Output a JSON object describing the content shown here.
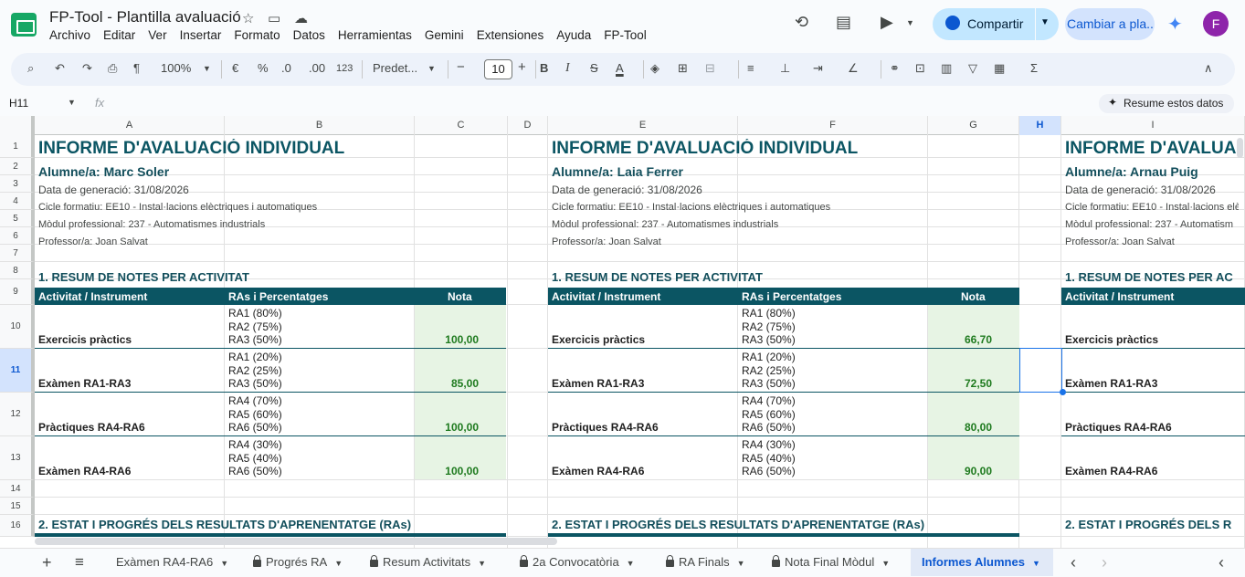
{
  "app": {
    "doc_title": "FP-Tool - Plantilla avaluació",
    "menu": [
      "Archivo",
      "Editar",
      "Ver",
      "Insertar",
      "Formato",
      "Datos",
      "Herramientas",
      "Gemini",
      "Extensiones",
      "Ayuda",
      "FP-Tool"
    ],
    "share_label": "Compartir",
    "plan_label": "Cambiar a pla...",
    "avatar_letter": "F"
  },
  "toolbar": {
    "zoom": "100%",
    "currency": "€",
    "percent": "%",
    "dec_less": ".0",
    "dec_more": ".00",
    "format_123": "123",
    "font": "Predet...",
    "font_size": "10",
    "minus": "−",
    "plus": "+"
  },
  "formula_bar": {
    "cell_ref": "H11",
    "fx": "fx",
    "summarize_label": "Resume estos datos"
  },
  "columns": [
    "A",
    "B",
    "C",
    "D",
    "E",
    "F",
    "G",
    "H",
    "I"
  ],
  "selected_column": "H",
  "rows": [
    "1",
    "2",
    "3",
    "4",
    "5",
    "6",
    "7",
    "8",
    "9",
    "10",
    "11",
    "12",
    "13",
    "14",
    "15",
    "16"
  ],
  "selected_row": "11",
  "reports": [
    {
      "title": "INFORME D'AVALUACIÓ INDIVIDUAL",
      "student": "Alumne/a: Marc Soler",
      "date": "Data de generació: 31/08/2026",
      "cycle": "Cicle formatiu: EE10 - Instal·lacions elèctriques i automatiques",
      "module": "Mòdul professional: 237 - Automatismes industrials",
      "teacher": "Professor/a: Joan Salvat",
      "section1": "1. RESUM DE NOTES PER ACTIVITAT",
      "th_activity": "Activitat / Instrument",
      "th_ras": "RAs i Percentatges",
      "th_grade": "Nota",
      "activities": [
        {
          "name": "Exercicis pràctics",
          "ras": [
            "RA1 (80%)",
            "RA2 (75%)",
            "RA3 (50%)"
          ],
          "grade": "100,00"
        },
        {
          "name": "Exàmen RA1-RA3",
          "ras": [
            "RA1 (20%)",
            "RA2 (25%)",
            "RA3 (50%)"
          ],
          "grade": "85,00"
        },
        {
          "name": "Pràctiques RA4-RA6",
          "ras": [
            "RA4 (70%)",
            "RA5 (60%)",
            "RA6 (50%)"
          ],
          "grade": "100,00"
        },
        {
          "name": "Exàmen RA4-RA6",
          "ras": [
            "RA4 (30%)",
            "RA5 (40%)",
            "RA6 (50%)"
          ],
          "grade": "100,00"
        }
      ],
      "section2": "2. ESTAT I PROGRÉS DELS RESULTATS D'APRENENTATGE (RAs)"
    },
    {
      "title": "INFORME D'AVALUACIÓ INDIVIDUAL",
      "student": "Alumne/a: Laia Ferrer",
      "date": "Data de generació: 31/08/2026",
      "cycle": "Cicle formatiu: EE10 - Instal·lacions elèctriques i automatiques",
      "module": "Mòdul professional: 237 - Automatismes industrials",
      "teacher": "Professor/a: Joan Salvat",
      "section1": "1. RESUM DE NOTES PER ACTIVITAT",
      "th_activity": "Activitat / Instrument",
      "th_ras": "RAs i Percentatges",
      "th_grade": "Nota",
      "activities": [
        {
          "name": "Exercicis pràctics",
          "ras": [
            "RA1 (80%)",
            "RA2 (75%)",
            "RA3 (50%)"
          ],
          "grade": "66,70"
        },
        {
          "name": "Exàmen RA1-RA3",
          "ras": [
            "RA1 (20%)",
            "RA2 (25%)",
            "RA3 (50%)"
          ],
          "grade": "72,50"
        },
        {
          "name": "Pràctiques RA4-RA6",
          "ras": [
            "RA4 (70%)",
            "RA5 (60%)",
            "RA6 (50%)"
          ],
          "grade": "80,00"
        },
        {
          "name": "Exàmen RA4-RA6",
          "ras": [
            "RA4 (30%)",
            "RA5 (40%)",
            "RA6 (50%)"
          ],
          "grade": "90,00"
        }
      ],
      "section2": "2. ESTAT I PROGRÉS DELS RESULTATS D'APRENENTATGE (RAs)"
    },
    {
      "title": "INFORME D'AVALUA",
      "student": "Alumne/a: Arnau Puig",
      "date": "Data de generació: 31/08/2026",
      "cycle": "Cicle formatiu: EE10 - Instal·lacions elè",
      "module": "Mòdul professional: 237 - Automatism",
      "teacher": "Professor/a: Joan Salvat",
      "section1": "1. RESUM DE NOTES PER AC",
      "th_activity": "Activitat / Instrument",
      "activities": [
        {
          "name": "Exercicis pràctics"
        },
        {
          "name": "Exàmen RA1-RA3"
        },
        {
          "name": "Pràctiques RA4-RA6"
        },
        {
          "name": "Exàmen RA4-RA6"
        }
      ],
      "section2": "2. ESTAT I PROGRÉS DELS R"
    }
  ],
  "sheet_tabs": [
    {
      "label": "Exàmen RA4-RA6",
      "locked": false,
      "active": false
    },
    {
      "label": "Progrés RA",
      "locked": true,
      "active": false
    },
    {
      "label": "Resum Activitats",
      "locked": true,
      "active": false
    },
    {
      "label": "2a Convocatòria",
      "locked": true,
      "active": false
    },
    {
      "label": "RA Finals",
      "locked": true,
      "active": false
    },
    {
      "label": "Nota Final Mòdul",
      "locked": true,
      "active": false
    },
    {
      "label": "Informes Alumnes",
      "locked": false,
      "active": true
    }
  ],
  "icons": {
    "add_sheet": "+",
    "all_sheets": "≡",
    "prev": "‹",
    "next": "›"
  },
  "colors": {
    "header_teal": "#0b5563",
    "grade_green_bg": "#e7f4e4",
    "grade_text": "#1e7a1e",
    "accent": "#0b57d0"
  }
}
